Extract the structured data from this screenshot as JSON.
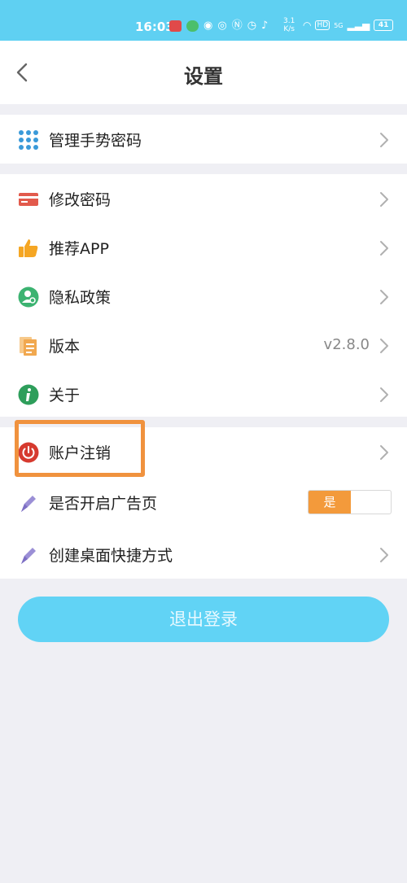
{
  "status_bar": {
    "time": "16:03",
    "speed": "3.1\nK/s",
    "network": "HD",
    "signal": "5G",
    "battery": "41"
  },
  "header": {
    "title": "设置",
    "back_icon": "chevron-left-icon"
  },
  "groups": [
    {
      "items": [
        {
          "label": "管理手势密码",
          "icon": "grid-dots-icon"
        }
      ]
    },
    {
      "items": [
        {
          "label": "修改密码",
          "icon": "card-icon"
        },
        {
          "label": "推荐APP",
          "icon": "thumbs-up-icon"
        },
        {
          "label": "隐私政策",
          "icon": "privacy-icon"
        },
        {
          "label": "版本",
          "icon": "document-icon",
          "value": "v2.8.0"
        },
        {
          "label": "关于",
          "icon": "info-icon"
        }
      ]
    },
    {
      "items": [
        {
          "label": "账户注销",
          "icon": "power-icon"
        },
        {
          "label": "是否开启广告页",
          "icon": "pen-icon",
          "toggle": "是",
          "toggle_on": true
        },
        {
          "label": "创建桌面快捷方式",
          "icon": "pen-icon"
        }
      ]
    }
  ],
  "logout_label": "退出登录",
  "colors": {
    "accent": "#5fd0f2",
    "toggle_on": "#f39a3b",
    "highlight": "#f0923e"
  }
}
